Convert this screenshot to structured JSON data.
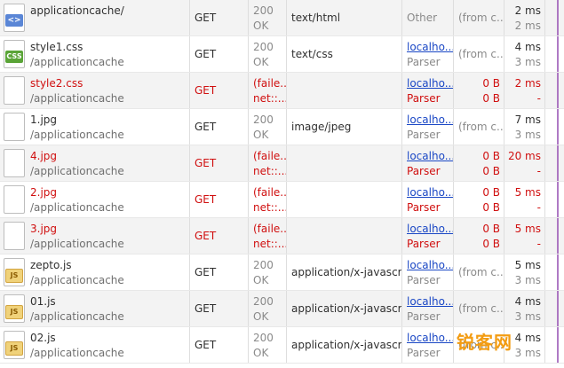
{
  "rows": [
    {
      "name": "applicationcache/",
      "path": "",
      "icon": "html-file-icon",
      "method": "GET",
      "status1": "200",
      "status2": "OK",
      "type": "text/html",
      "initiator1": "Other",
      "initiator2": "",
      "initiator_link": false,
      "size1": "(from c...",
      "size2": "",
      "time1": "2 ms",
      "time2": "2 ms",
      "error": false
    },
    {
      "name": "style1.css",
      "path": "/applicationcache",
      "icon": "css-file-icon",
      "method": "GET",
      "status1": "200",
      "status2": "OK",
      "type": "text/css",
      "initiator1": "localho...",
      "initiator2": "Parser",
      "initiator_link": true,
      "size1": "(from c...",
      "size2": "",
      "time1": "4 ms",
      "time2": "3 ms",
      "error": false
    },
    {
      "name": "style2.css",
      "path": "/applicationcache",
      "icon": "blank-file-icon",
      "method": "GET",
      "status1": "(faile...",
      "status2": "net::...",
      "type": "",
      "initiator1": "localho...",
      "initiator2": "Parser",
      "initiator_link": true,
      "size1": "0 B",
      "size2": "0 B",
      "time1": "2 ms",
      "time2": "-",
      "error": true
    },
    {
      "name": "1.jpg",
      "path": "/applicationcache",
      "icon": "image-file-icon",
      "method": "GET",
      "status1": "200",
      "status2": "OK",
      "type": "image/jpeg",
      "initiator1": "localho...",
      "initiator2": "Parser",
      "initiator_link": true,
      "size1": "(from c...",
      "size2": "",
      "time1": "7 ms",
      "time2": "3 ms",
      "error": false
    },
    {
      "name": "4.jpg",
      "path": "/applicationcache",
      "icon": "blank-file-icon",
      "method": "GET",
      "status1": "(faile...",
      "status2": "net::...",
      "type": "",
      "initiator1": "localho...",
      "initiator2": "Parser",
      "initiator_link": true,
      "size1": "0 B",
      "size2": "0 B",
      "time1": "20 ms",
      "time2": "-",
      "error": true
    },
    {
      "name": "2.jpg",
      "path": "/applicationcache",
      "icon": "blank-file-icon",
      "method": "GET",
      "status1": "(faile...",
      "status2": "net::...",
      "type": "",
      "initiator1": "localho...",
      "initiator2": "Parser",
      "initiator_link": true,
      "size1": "0 B",
      "size2": "0 B",
      "time1": "5 ms",
      "time2": "-",
      "error": true
    },
    {
      "name": "3.jpg",
      "path": "/applicationcache",
      "icon": "blank-file-icon",
      "method": "GET",
      "status1": "(faile...",
      "status2": "net::...",
      "type": "",
      "initiator1": "localho...",
      "initiator2": "Parser",
      "initiator_link": true,
      "size1": "0 B",
      "size2": "0 B",
      "time1": "5 ms",
      "time2": "-",
      "error": true
    },
    {
      "name": "zepto.js",
      "path": "/applicationcache",
      "icon": "js-file-icon",
      "method": "GET",
      "status1": "200",
      "status2": "OK",
      "type": "application/x-javascri...",
      "initiator1": "localho...",
      "initiator2": "Parser",
      "initiator_link": true,
      "size1": "(from c...",
      "size2": "",
      "time1": "5 ms",
      "time2": "3 ms",
      "error": false
    },
    {
      "name": "01.js",
      "path": "/applicationcache",
      "icon": "js-file-icon",
      "method": "GET",
      "status1": "200",
      "status2": "OK",
      "type": "application/x-javascri...",
      "initiator1": "localho...",
      "initiator2": "Parser",
      "initiator_link": true,
      "size1": "(from c...",
      "size2": "",
      "time1": "4 ms",
      "time2": "3 ms",
      "error": false
    },
    {
      "name": "02.js",
      "path": "/applicationcache",
      "icon": "js-file-icon",
      "method": "GET",
      "status1": "200",
      "status2": "OK",
      "type": "application/x-javascri...",
      "initiator1": "localho...",
      "initiator2": "Parser",
      "initiator_link": true,
      "size1": "(from c...",
      "size2": "",
      "time1": "4 ms",
      "time2": "3 ms",
      "error": false
    }
  ],
  "watermark": "锐客网",
  "colors": {
    "error": "#d00f0f",
    "link": "#1a47c5",
    "timeline": "#9b59b6",
    "alt_row": "#f3f3f3"
  }
}
